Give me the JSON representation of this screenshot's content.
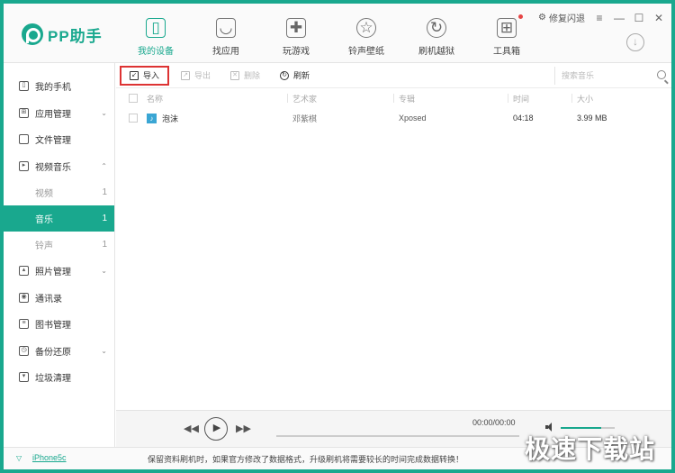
{
  "app": {
    "logo_text": "PP助手"
  },
  "nav": [
    {
      "label": "我的设备",
      "icon": "phone-icon",
      "glyph": "▯",
      "active": true
    },
    {
      "label": "找应用",
      "icon": "bag-icon",
      "glyph": "◡",
      "active": false
    },
    {
      "label": "玩游戏",
      "icon": "gamepad-icon",
      "glyph": "✚",
      "active": false
    },
    {
      "label": "铃声壁纸",
      "icon": "star-icon",
      "glyph": "☆",
      "active": false
    },
    {
      "label": "刷机越狱",
      "icon": "refresh-icon",
      "glyph": "↻",
      "active": false
    },
    {
      "label": "工具箱",
      "icon": "toolbox-icon",
      "glyph": "⊞",
      "active": false
    }
  ],
  "window_controls": {
    "repair": "修复闪退",
    "menu": "≡",
    "minimize": "—",
    "maximize": "☐",
    "close": "✕",
    "download": "↓"
  },
  "sidebar": {
    "items": [
      {
        "label": "我的手机",
        "icon": "phone-icon",
        "glyph": "▯"
      },
      {
        "label": "应用管理",
        "icon": "apps-icon",
        "glyph": "⊞",
        "chevron": "⌄"
      },
      {
        "label": "文件管理",
        "icon": "folder-icon",
        "glyph": ""
      },
      {
        "label": "视频音乐",
        "icon": "video-icon",
        "glyph": "▸",
        "chevron": "⌃"
      }
    ],
    "subitems": [
      {
        "label": "视频",
        "count": "1",
        "active": false
      },
      {
        "label": "音乐",
        "count": "1",
        "active": true
      },
      {
        "label": "铃声",
        "count": "1",
        "active": false
      }
    ],
    "items2": [
      {
        "label": "照片管理",
        "icon": "photo-icon",
        "glyph": "▴",
        "chevron": "⌄"
      },
      {
        "label": "通讯录",
        "icon": "contacts-icon",
        "glyph": "◉"
      },
      {
        "label": "图书管理",
        "icon": "book-icon",
        "glyph": "≡"
      },
      {
        "label": "备份还原",
        "icon": "backup-icon",
        "glyph": "◷",
        "chevron": "⌄"
      },
      {
        "label": "垃圾清理",
        "icon": "trash-icon",
        "glyph": "▾"
      }
    ]
  },
  "toolbar": {
    "import": "导入",
    "export": "导出",
    "delete": "删除",
    "refresh": "刷新",
    "search_placeholder": "搜索音乐"
  },
  "table": {
    "headers": {
      "name": "名称",
      "artist": "艺术家",
      "album": "专辑",
      "time": "时间",
      "size": "大小"
    },
    "rows": [
      {
        "name": "泡沫",
        "artist": "邓紫棋",
        "album": "Xposed",
        "time": "04:18",
        "size": "3.99 MB"
      }
    ]
  },
  "player": {
    "time": "00:00/00:00",
    "volume": 0.75
  },
  "status": {
    "device": "iPhone5c",
    "message": "保留资料刷机时，如果官方修改了数据格式，升级刷机将需要较长的时间完成数据转换！"
  },
  "watermark": "极速下载站",
  "colors": {
    "accent": "#19a88e",
    "highlight_border": "#dd3333",
    "notification_dot": "#e64545"
  }
}
